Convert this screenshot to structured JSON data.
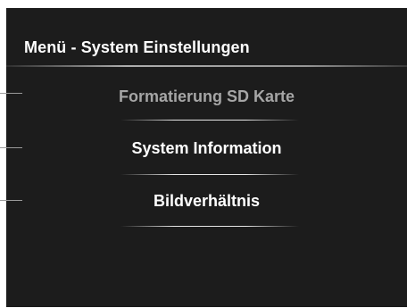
{
  "menu": {
    "title": "Menü - System Einstellungen",
    "items": [
      {
        "label": "Formatierung SD Karte",
        "state": "disabled"
      },
      {
        "label": "System Information",
        "state": "enabled"
      },
      {
        "label": "Bildverhältnis",
        "state": "enabled"
      }
    ]
  },
  "colors": {
    "background": "#1c1c1c",
    "text": "#ffffff",
    "disabled_text": "#a6a6a6"
  }
}
